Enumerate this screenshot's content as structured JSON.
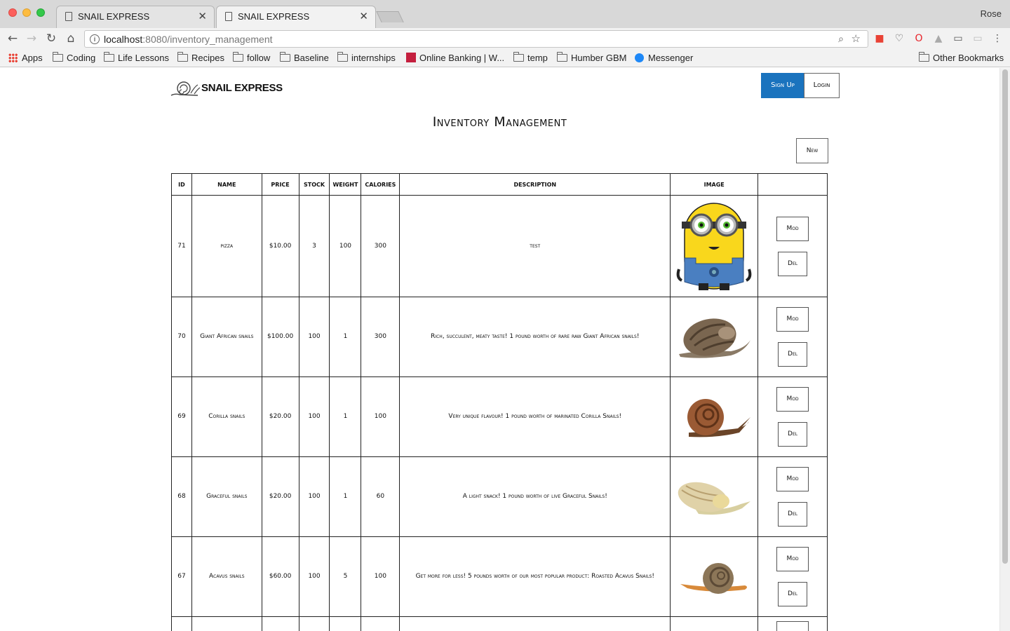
{
  "browser": {
    "tabs": [
      {
        "title": "SNAIL EXPRESS",
        "active": false
      },
      {
        "title": "SNAIL EXPRESS",
        "active": true
      }
    ],
    "profile": "Rose",
    "url_host": "localhost",
    "url_rest": ":8080/inventory_management",
    "bookmarks": [
      {
        "label": "Apps",
        "icon": "apps-icon"
      },
      {
        "label": "Coding",
        "icon": "folder-icon"
      },
      {
        "label": "Life Lessons",
        "icon": "folder-icon"
      },
      {
        "label": "Recipes",
        "icon": "folder-icon"
      },
      {
        "label": "follow",
        "icon": "folder-icon"
      },
      {
        "label": "Baseline",
        "icon": "folder-icon"
      },
      {
        "label": "internships",
        "icon": "folder-icon"
      },
      {
        "label": "Online Banking | W...",
        "icon": "cibc-icon"
      },
      {
        "label": "temp",
        "icon": "folder-icon"
      },
      {
        "label": "Humber GBM",
        "icon": "folder-icon"
      },
      {
        "label": "Messenger",
        "icon": "messenger-icon"
      },
      {
        "label": "Other Bookmarks",
        "icon": "folder-icon"
      }
    ]
  },
  "header": {
    "logo_text": "SNAIL EXPRESS",
    "signup_label": "Sign Up",
    "login_label": "Login"
  },
  "page": {
    "title": "Inventory Management",
    "new_label": "New"
  },
  "table": {
    "columns": [
      "ID",
      "NAME",
      "PRICE",
      "STOCK",
      "WEIGHT",
      "CALORIES",
      "DESCRIPTION",
      "IMAGE",
      ""
    ],
    "rows": [
      {
        "id": "71",
        "name": "pizza",
        "price": "$10.00",
        "stock": "3",
        "weight": "100",
        "calories": "300",
        "description": "test",
        "image": "minion",
        "mod": "Mod",
        "del": "Del"
      },
      {
        "id": "70",
        "name": "Giant African snails",
        "price": "$100.00",
        "stock": "100",
        "weight": "1",
        "calories": "300",
        "description": "Rich, succulent, meaty taste! 1 pound worth of rare raw Giant African snails!",
        "image": "snail-brown",
        "mod": "Mod",
        "del": "Del"
      },
      {
        "id": "69",
        "name": "Corilla snails",
        "price": "$20.00",
        "stock": "100",
        "weight": "1",
        "calories": "100",
        "description": "Very unique flavour! 1 pound worth of marinated Corilla Snails!",
        "image": "snail-red",
        "mod": "Mod",
        "del": "Del"
      },
      {
        "id": "68",
        "name": "Graceful snails",
        "price": "$20.00",
        "stock": "100",
        "weight": "1",
        "calories": "60",
        "description": "A light snack! 1 pound worth of live Graceful Snails!",
        "image": "snail-pale",
        "mod": "Mod",
        "del": "Del"
      },
      {
        "id": "67",
        "name": "Acavus snails",
        "price": "$60.00",
        "stock": "100",
        "weight": "5",
        "calories": "100",
        "description": "Get more for less! 5 pounds worth of our most popular product: Roasted Acavus Snails!",
        "image": "snail-orange",
        "mod": "Mod",
        "del": "Del"
      }
    ]
  }
}
